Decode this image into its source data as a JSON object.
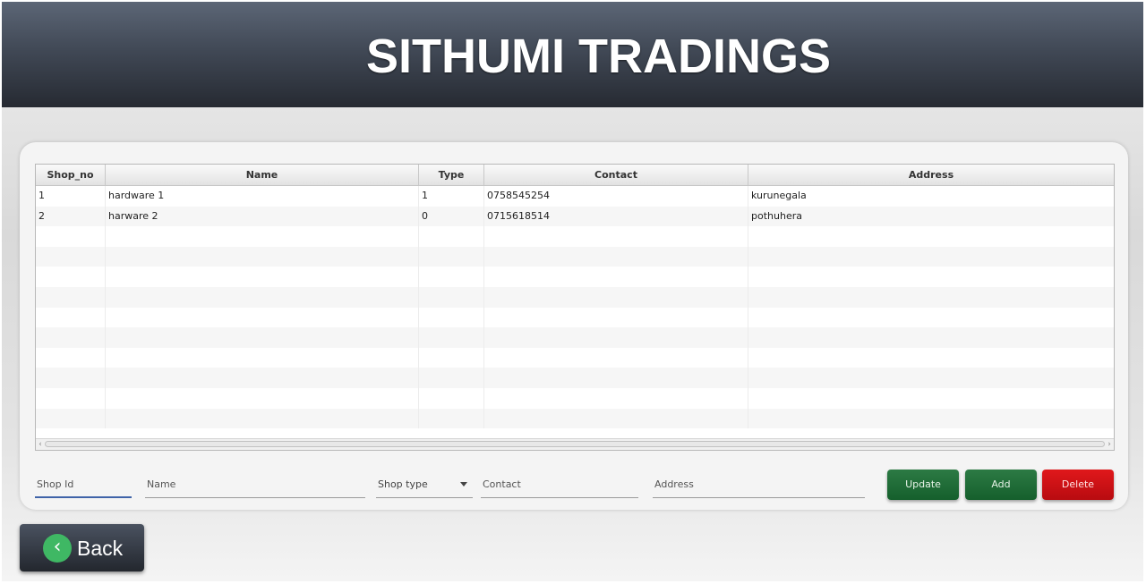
{
  "header": {
    "title": "SITHUMI TRADINGS"
  },
  "table": {
    "columns": [
      "Shop_no",
      "Name",
      "Type",
      "Contact",
      "Address"
    ],
    "rows": [
      [
        "1",
        "hardware 1",
        "1",
        "0758545254",
        "kurunegala"
      ],
      [
        "2",
        "harware 2",
        "0",
        "0715618514",
        "pothuhera"
      ]
    ]
  },
  "form": {
    "shop_id": {
      "placeholder": "Shop Id",
      "value": ""
    },
    "name": {
      "placeholder": "Name",
      "value": ""
    },
    "shop_type": {
      "placeholder": "Shop type"
    },
    "contact": {
      "placeholder": "Contact",
      "value": ""
    },
    "address": {
      "placeholder": "Address",
      "value": ""
    }
  },
  "buttons": {
    "update": "Update",
    "add": "Add",
    "delete": "Delete"
  },
  "back": {
    "label": "Back",
    "icon": "chevron-left-icon"
  },
  "colors": {
    "update": "#1e6b36",
    "add": "#1e6b36",
    "delete": "#d11317",
    "back_icon": "#3fb864"
  }
}
